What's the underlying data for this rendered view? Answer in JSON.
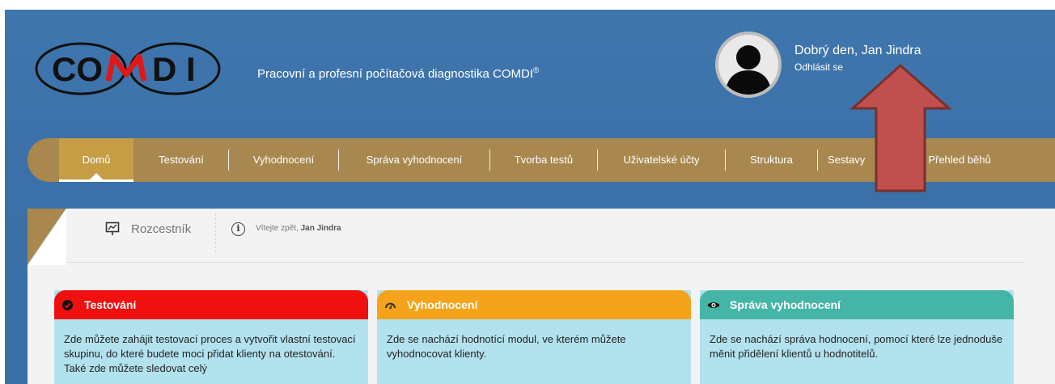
{
  "header": {
    "logo_text": "COMDI",
    "tagline": "Pracovní a profesní počítačová diagnostika COMDI",
    "tagline_mark": "®",
    "greeting": "Dobrý den, Jan Jindra",
    "logout": "Odhlásit se"
  },
  "nav": {
    "items": [
      {
        "label": "Domů",
        "active": true
      },
      {
        "label": "Testování"
      },
      {
        "label": "Vyhodnocení"
      },
      {
        "label": "Správa vyhodnocení"
      },
      {
        "label": "Tvorba testů"
      },
      {
        "label": "Uživatelské účty"
      },
      {
        "label": "Struktura"
      },
      {
        "label": "Sestavy"
      },
      {
        "label": "Přehled běhů"
      }
    ]
  },
  "breadcrumb": {
    "label": "Rozcestník",
    "welcome_prefix": "Vítejte zpět,",
    "welcome_name": "Jan Jindra"
  },
  "cards": [
    {
      "title": "Testování",
      "icon": "check-circle-icon",
      "color": "#f01010",
      "text": "Zde můžete zahájit testovací proces a vytvořit vlastní testovací skupinu, do které budete moci přidat klienty na otestování. Také zde můžete sledovat celý"
    },
    {
      "title": "Vyhodnocení",
      "icon": "gauge-icon",
      "color": "#f5a31a",
      "text": "Zde se nachází hodnotící modul, ve kterém můžete vyhodnocovat klienty."
    },
    {
      "title": "Správa vyhodnocení",
      "icon": "eye-icon",
      "color": "#45b5a7",
      "text": "Zde se nachází správa hodnocení, pomocí které lze jednoduše měnit přidělení klientů u hodnotitelů."
    }
  ],
  "colors": {
    "background": "#3f76ad",
    "nav": "#a8884f",
    "nav_active": "#c69d45",
    "card_body": "#b3e2ef",
    "arrow": "#c0504d"
  }
}
